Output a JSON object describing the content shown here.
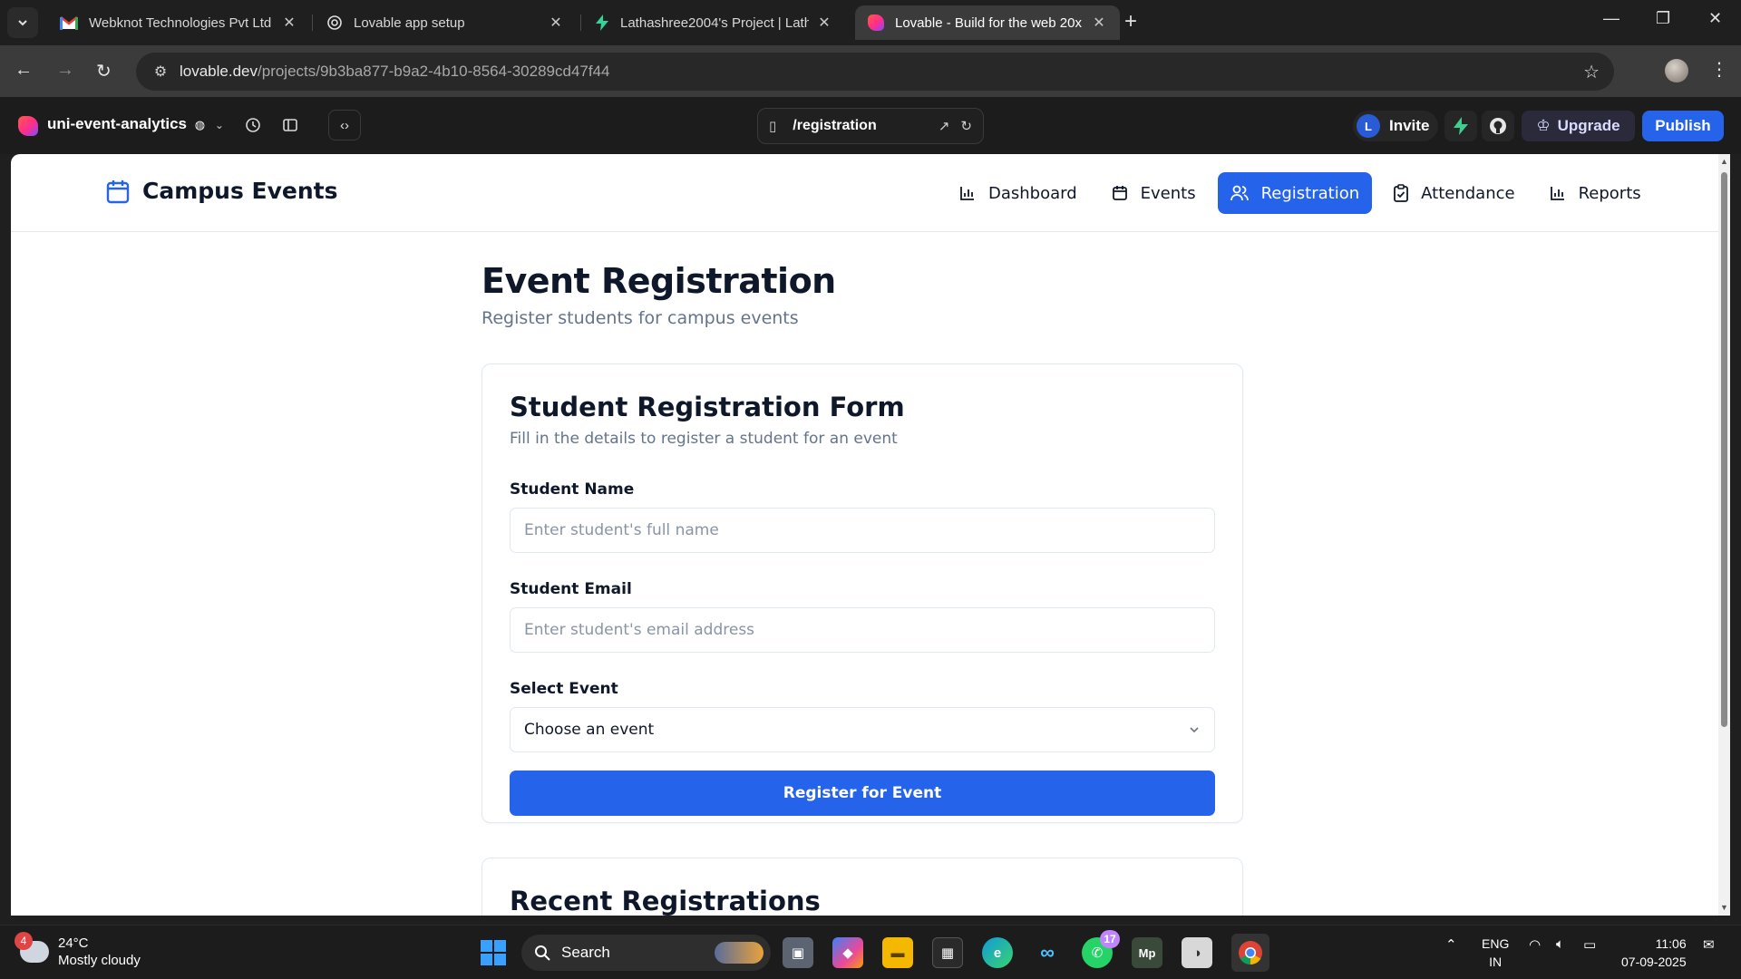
{
  "browser": {
    "tabs": [
      {
        "title": "Webknot Technologies Pvt Ltd (",
        "icon": "gmail-icon",
        "active": false
      },
      {
        "title": "Lovable app setup",
        "icon": "openai-icon",
        "active": false
      },
      {
        "title": "Lathashree2004's Project | Latha",
        "icon": "bolt-icon",
        "active": false
      },
      {
        "title": "Lovable - Build for the web 20x",
        "icon": "lovable-icon",
        "active": true
      }
    ],
    "url_host": "lovable.dev",
    "url_path": "/projects/9b3ba877-b9a2-4b10-8564-30289cd47f44"
  },
  "lovable_toolbar": {
    "project_name": "uni-event-analytics",
    "route": "/registration",
    "invite_avatar": "L",
    "invite_label": "Invite",
    "upgrade_label": "Upgrade",
    "publish_label": "Publish"
  },
  "app": {
    "brand": "Campus Events",
    "nav": [
      {
        "label": "Dashboard",
        "icon": "bar-chart-icon",
        "active": false
      },
      {
        "label": "Events",
        "icon": "calendar-icon",
        "active": false
      },
      {
        "label": "Registration",
        "icon": "users-icon",
        "active": true
      },
      {
        "label": "Attendance",
        "icon": "clipboard-check-icon",
        "active": false
      },
      {
        "label": "Reports",
        "icon": "bar-chart-icon",
        "active": false
      }
    ],
    "page_title": "Event Registration",
    "page_subtitle": "Register students for campus events",
    "form": {
      "title": "Student Registration Form",
      "subtitle": "Fill in the details to register a student for an event",
      "name_label": "Student Name",
      "name_placeholder": "Enter student's full name",
      "email_label": "Student Email",
      "email_placeholder": "Enter student's email address",
      "event_label": "Select Event",
      "event_value": "Choose an event",
      "submit_label": "Register for Event"
    },
    "recent": {
      "title": "Recent Registrations"
    }
  },
  "taskbar": {
    "weather_badge": "4",
    "temperature": "24°C",
    "weather": "Mostly cloudy",
    "search_label": "Search",
    "whatsapp_badge": "17",
    "lang_top": "ENG",
    "lang_bottom": "IN",
    "time": "11:06",
    "date": "07-09-2025"
  },
  "colors": {
    "accent": "#2563eb",
    "chrome_bg": "#1f1f1f",
    "text_muted": "#64748b"
  }
}
